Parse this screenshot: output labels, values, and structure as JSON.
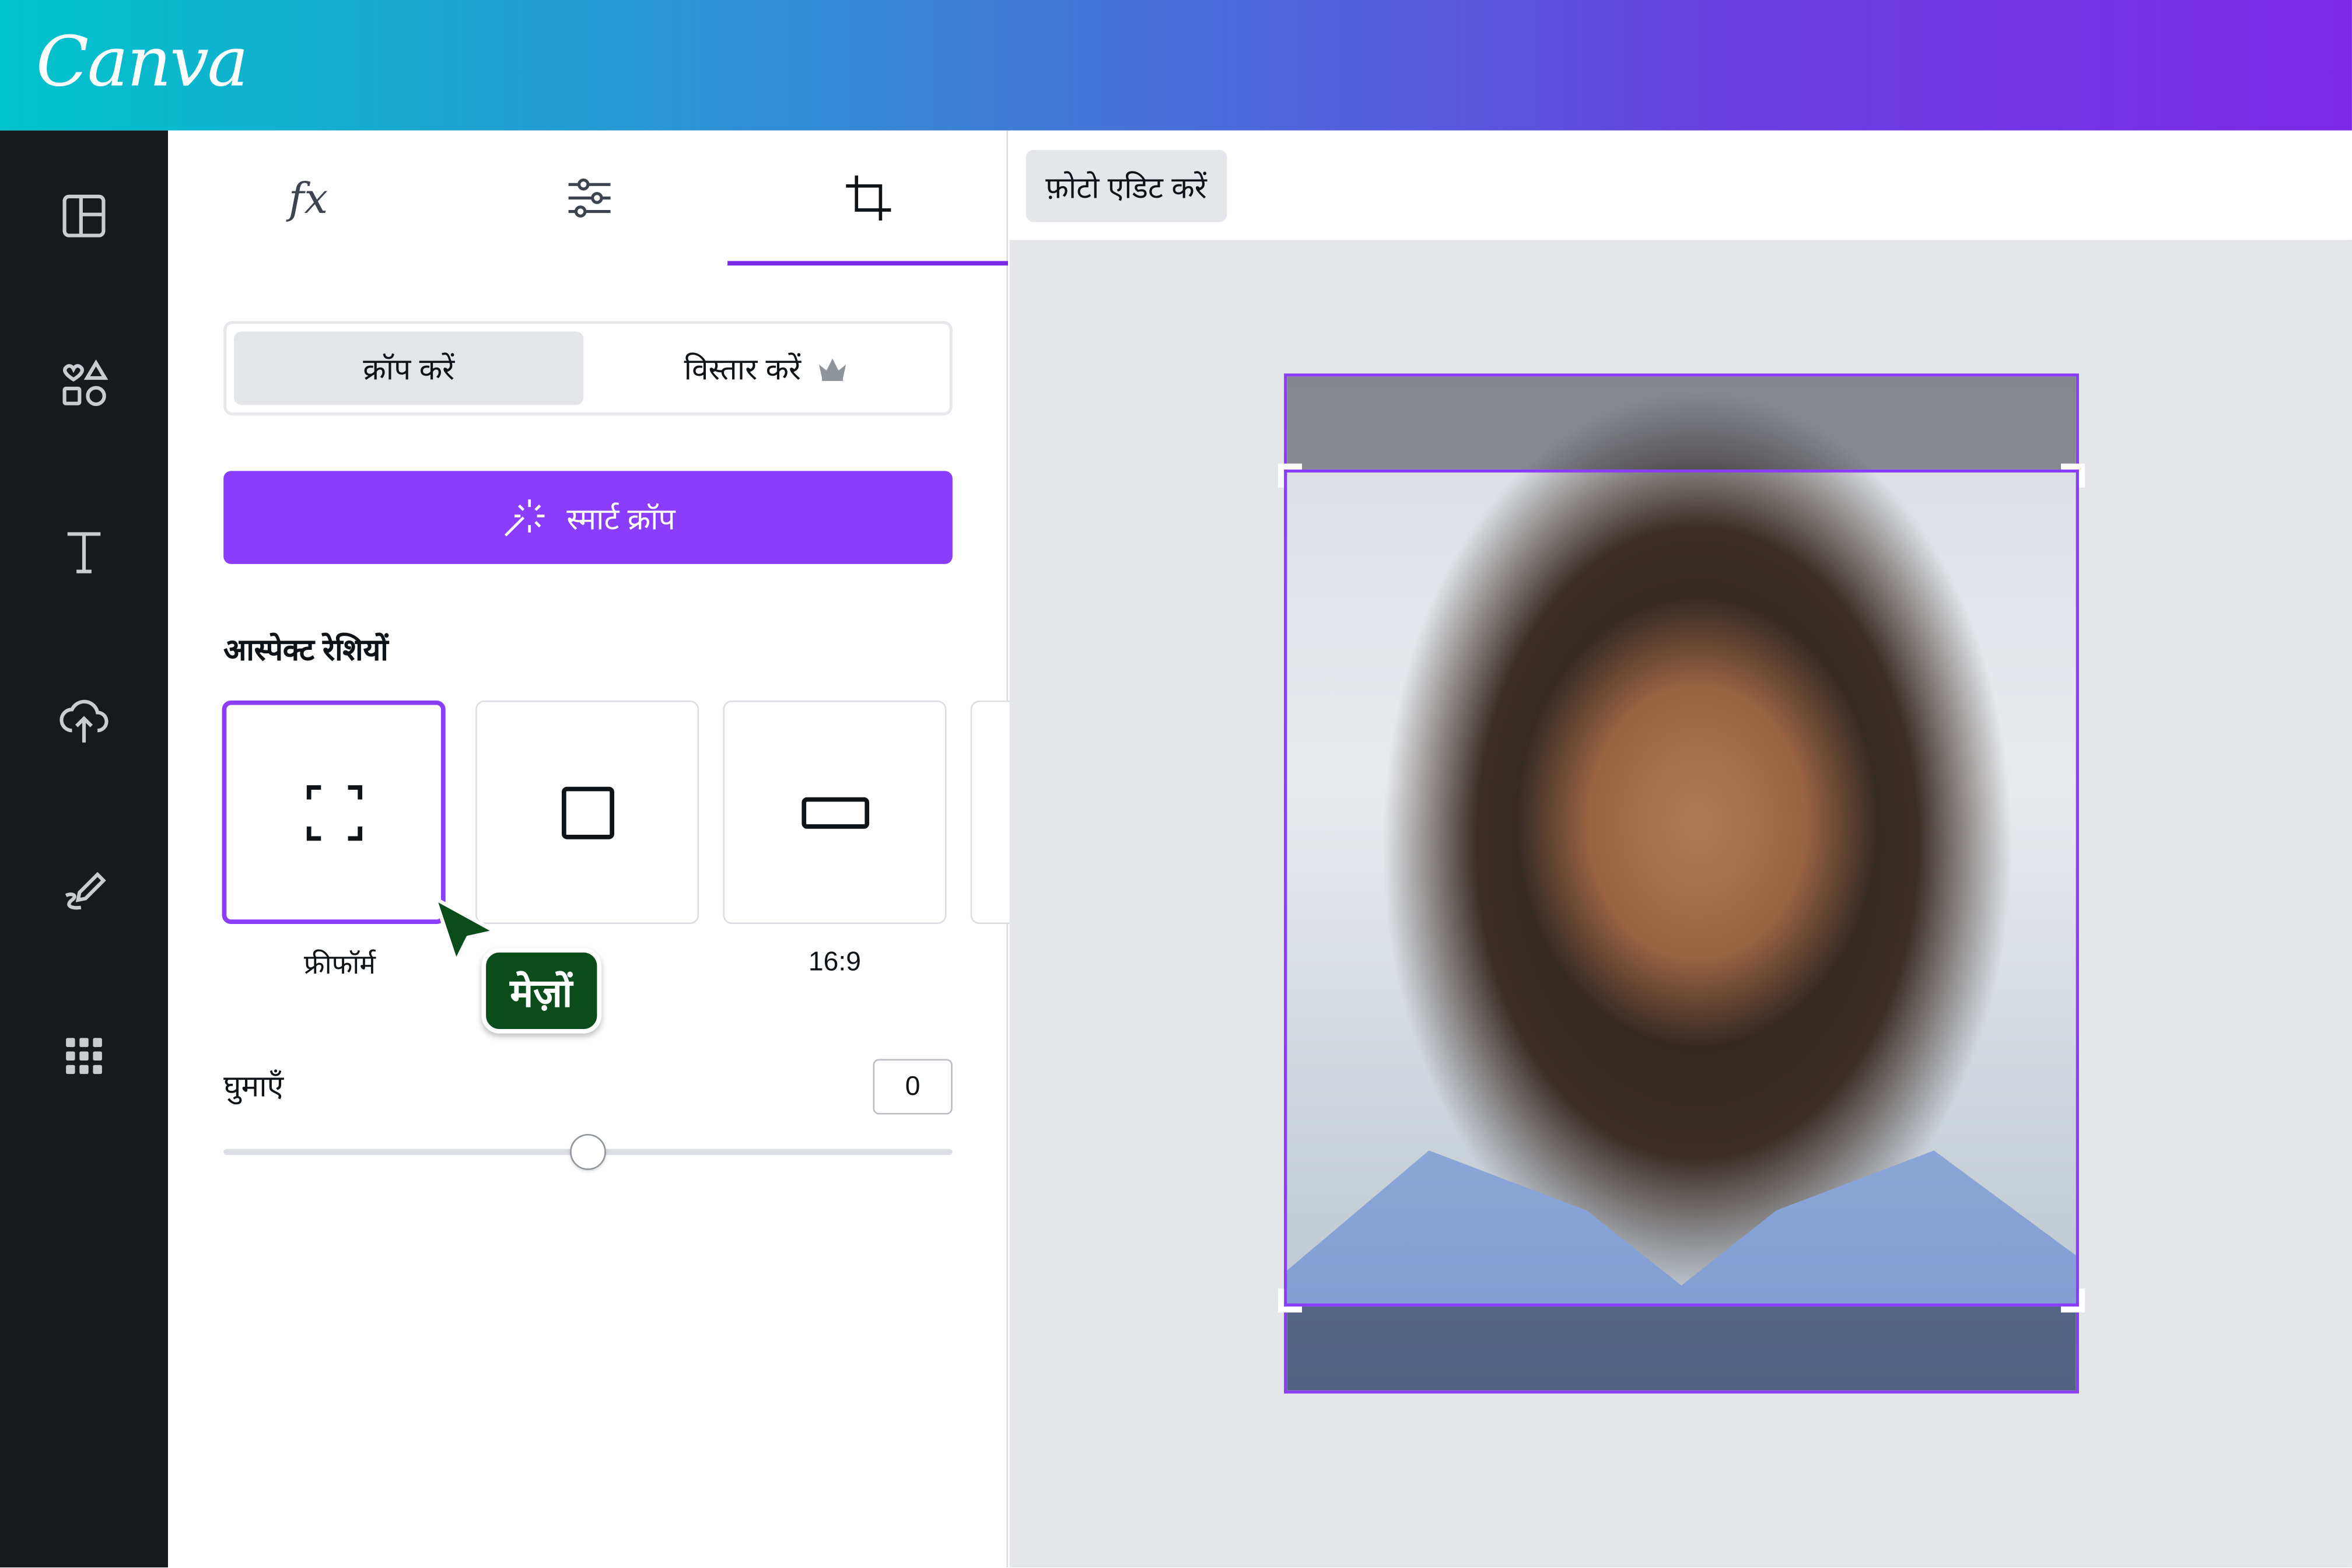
{
  "app": {
    "logo": "Canva"
  },
  "colors": {
    "accent": "#8b3dff",
    "rail_bg": "#18191b",
    "tooltip_bg": "#0b4d1a"
  },
  "rail": {
    "items": [
      {
        "icon": "layout-icon"
      },
      {
        "icon": "elements-icon"
      },
      {
        "icon": "text-icon"
      },
      {
        "icon": "upload-cloud-icon"
      },
      {
        "icon": "draw-icon"
      },
      {
        "icon": "apps-grid-icon"
      }
    ]
  },
  "panel": {
    "tabs": [
      {
        "icon": "fx-icon",
        "label": "fx"
      },
      {
        "icon": "adjust-sliders-icon"
      },
      {
        "icon": "crop-icon",
        "active": true
      }
    ],
    "segment": {
      "crop": "क्रॉप करें",
      "expand": "विस्तार करें",
      "expand_icon": "crown-icon"
    },
    "smart_crop": "स्मार्ट क्रॉप",
    "aspect_title": "आस्पेक्ट रेशियों",
    "ratios": [
      {
        "label": "फ्रीफॉर्म",
        "icon": "freeform-icon",
        "selected": true
      },
      {
        "label": "",
        "icon": "square-icon"
      },
      {
        "label": "16:9",
        "icon": "wide-rect-icon"
      }
    ],
    "tooltip": "मेज़ों",
    "rotate_label": "घुमाएँ",
    "rotate_value": "0",
    "rotate_fraction": 0.5
  },
  "toolbar": {
    "edit_photo": "फ़ोटो एडिट करें"
  }
}
